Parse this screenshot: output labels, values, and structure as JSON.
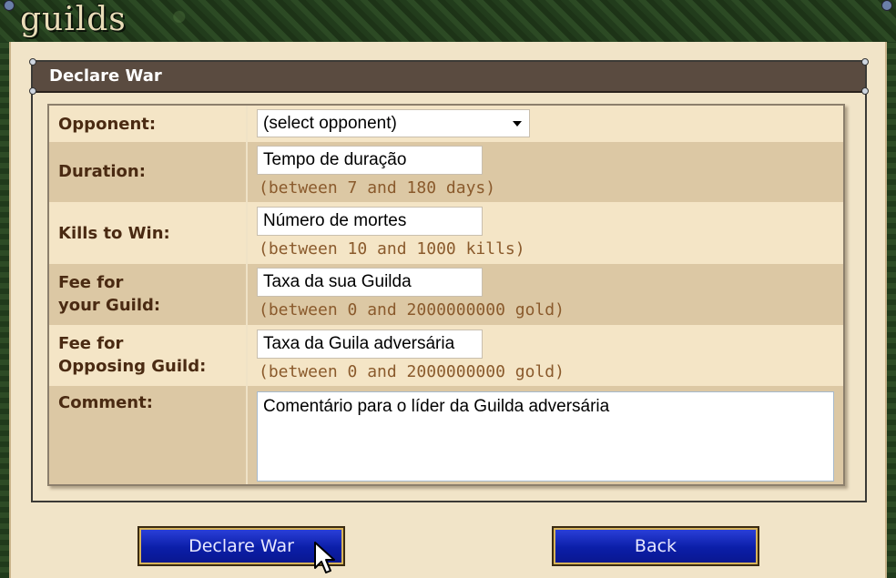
{
  "window": {
    "title": "guilds"
  },
  "dialog": {
    "title": "Declare War"
  },
  "form": {
    "opponent": {
      "label": "Opponent:",
      "selected": "(select opponent)"
    },
    "duration": {
      "label": "Duration:",
      "value": "Tempo de duração",
      "hint": "(between 7 and 180 days)"
    },
    "kills": {
      "label": "Kills to Win:",
      "value": "Número de mortes",
      "hint": "(between 10 and 1000 kills)"
    },
    "fee_own": {
      "label_line1": "Fee for",
      "label_line2": "your Guild:",
      "value": "Taxa da sua Guilda",
      "hint": "(between 0 and 2000000000 gold)"
    },
    "fee_opponent": {
      "label_line1": "Fee for",
      "label_line2": "Opposing Guild:",
      "value": "Taxa da Guila adversária",
      "hint": "(between 0 and 2000000000 gold)"
    },
    "comment": {
      "label": "Comment:",
      "value": "Comentário para o líder da Guilda adversária"
    }
  },
  "buttons": {
    "declare": "Declare War",
    "back": "Back"
  },
  "colors": {
    "banner_green": "#223c1c",
    "parchment": "#f1e4c8",
    "header_brown": "#5a4b40",
    "label_brown": "#4a2a12",
    "hint_brown": "#8a5a2c",
    "button_blue": "#0b1ea8",
    "button_border_gold": "#d7b35a"
  },
  "icons": {
    "dropdown": "chevron-down-icon",
    "cursor": "mouse-pointer-icon"
  }
}
